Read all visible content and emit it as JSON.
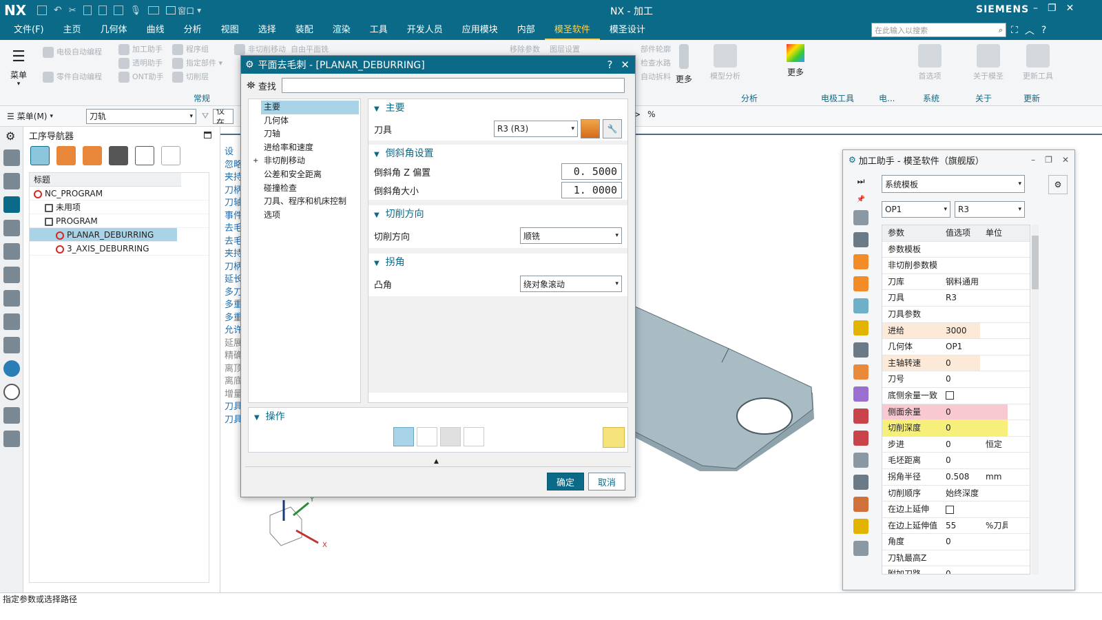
{
  "titlebar": {
    "logo": "NX",
    "title": "NX - 加工",
    "brand": "SIEMENS",
    "window_menu": "窗口"
  },
  "menubar": {
    "items": [
      "文件(F)",
      "主页",
      "几何体",
      "曲线",
      "分析",
      "视图",
      "选择",
      "装配",
      "渲染",
      "工具",
      "开发人员",
      "应用模块",
      "内部",
      "模圣软件",
      "模圣设计"
    ],
    "active": "模圣软件",
    "search_placeholder": "在此输入以搜索"
  },
  "ribbon": {
    "menu_label": "菜单",
    "col1": [
      "电极自动编程",
      "零件自动编程"
    ],
    "col2": [
      "加工助手",
      "透明助手",
      "ONT助手"
    ],
    "col3": [
      "程序组",
      "指定部件",
      "切削层"
    ],
    "col4": [
      "非切削移动",
      "自由平面铣"
    ],
    "group_common": "常规",
    "right_labels": [
      "移除参数",
      "图层设置",
      "部件轮廓",
      "检查水路",
      "自动拆料"
    ],
    "more": "更多",
    "analysis_items": [
      "模型分析",
      "更多"
    ],
    "groups": [
      "分析",
      "电极工具",
      "电...",
      "系统",
      "关于",
      "更新"
    ],
    "tools": [
      "首选项",
      "关于模圣",
      "更新工具"
    ]
  },
  "toolbar2": {
    "menu": "菜单(M)",
    "combo": "刀轨",
    "filter": "仅在"
  },
  "navigator": {
    "title": "工序导航器",
    "column": "标题",
    "rows": [
      {
        "label": "NC_PROGRAM",
        "indent": 0
      },
      {
        "label": "未用项",
        "indent": 1
      },
      {
        "label": "PROGRAM",
        "indent": 1
      },
      {
        "label": "PLANAR_DEBURRING",
        "indent": 2,
        "selected": true
      },
      {
        "label": "3_AXIS_DEBURRING",
        "indent": 2
      }
    ]
  },
  "behind_list": [
    "设",
    "忽略",
    "夹持",
    "刀柄",
    "刀轴",
    "事件",
    "去毛",
    "去毛",
    "夹持",
    "刀柄",
    "延长",
    "多刀",
    "多重",
    "多重",
    "允许",
    "延展",
    "精确",
    "离顶",
    "离底",
    "增量",
    "刀具",
    "刀具"
  ],
  "dialog": {
    "title": "平面去毛刺 - [PLANAR_DEBURRING]",
    "find_label": "查找",
    "tree": [
      "主要",
      "几何体",
      "刀轴",
      "进给率和速度",
      "非切削移动",
      "公差和安全距离",
      "碰撞检查",
      "刀具、程序和机床控制",
      "选项"
    ],
    "sec_main": "主要",
    "tool_label": "刀具",
    "tool_value": "R3 (R3)",
    "sec_chamfer": "倒斜角设置",
    "chamfer_z_label": "倒斜角 Z 偏置",
    "chamfer_z_value": "0. 5000",
    "chamfer_size_label": "倒斜角大小",
    "chamfer_size_value": "1. 0000",
    "sec_cutdir": "切削方向",
    "cutdir_label": "切削方向",
    "cutdir_value": "顺铣",
    "sec_corner": "拐角",
    "convex_label": "凸角",
    "convex_value": "绕对象滚动",
    "sec_ops": "操作",
    "ok": "确定",
    "cancel": "取消"
  },
  "assist": {
    "title": "加工助手 - 模圣软件（旗舰版）",
    "template": "系统模板",
    "op": "OP1",
    "tool": "R3",
    "headers": [
      "参数",
      "值选项",
      "单位"
    ],
    "rows": [
      {
        "p": "参数模板",
        "v": "",
        "u": "",
        "bg": ""
      },
      {
        "p": "非切削参数模",
        "v": "",
        "u": "",
        "bg": ""
      },
      {
        "p": "刀库",
        "v": "钢料通用",
        "u": "",
        "bg": ""
      },
      {
        "p": "刀具",
        "v": "R3",
        "u": "",
        "bg": ""
      },
      {
        "p": "刀具参数",
        "v": "",
        "u": "",
        "bg": ""
      },
      {
        "p": "进给",
        "v": "3000",
        "u": "",
        "bg": "#fde9d8"
      },
      {
        "p": "几何体",
        "v": "OP1",
        "u": "",
        "bg": ""
      },
      {
        "p": "主轴转速",
        "v": "0",
        "u": "",
        "bg": "#fde9d8"
      },
      {
        "p": "刀号",
        "v": "0",
        "u": "",
        "bg": ""
      },
      {
        "p": "底侧余量一致",
        "v": "",
        "u": "",
        "bg": "",
        "check": true
      },
      {
        "p": "侧面余量",
        "v": "0",
        "u": "",
        "bg": "#f9c9d2"
      },
      {
        "p": "切削深度",
        "v": "0",
        "u": "",
        "bg": "#f6f07a"
      },
      {
        "p": "步进",
        "v": "0",
        "u": "恒定",
        "bg": ""
      },
      {
        "p": "毛坯距离",
        "v": "0",
        "u": "",
        "bg": ""
      },
      {
        "p": "拐角半径",
        "v": "0.508",
        "u": "mm",
        "bg": ""
      },
      {
        "p": "切削顺序",
        "v": "始终深度",
        "u": "",
        "bg": ""
      },
      {
        "p": "在边上延伸",
        "v": "",
        "u": "",
        "bg": "",
        "check": true
      },
      {
        "p": "在边上延伸值",
        "v": "55",
        "u": "%刀具",
        "bg": ""
      },
      {
        "p": "角度",
        "v": "0",
        "u": "",
        "bg": ""
      },
      {
        "p": "刀轨最高Z",
        "v": "",
        "u": "",
        "bg": ""
      },
      {
        "p": "附加刀路",
        "v": "0",
        "u": "",
        "bg": ""
      }
    ]
  },
  "status": "指定参数或选择路径",
  "axes": {
    "x": "X",
    "y": "Y"
  },
  "colors": {
    "accent": "#0b6a88",
    "selected": "#a9d3e6",
    "highlight_yellow": "#f6f07a"
  }
}
